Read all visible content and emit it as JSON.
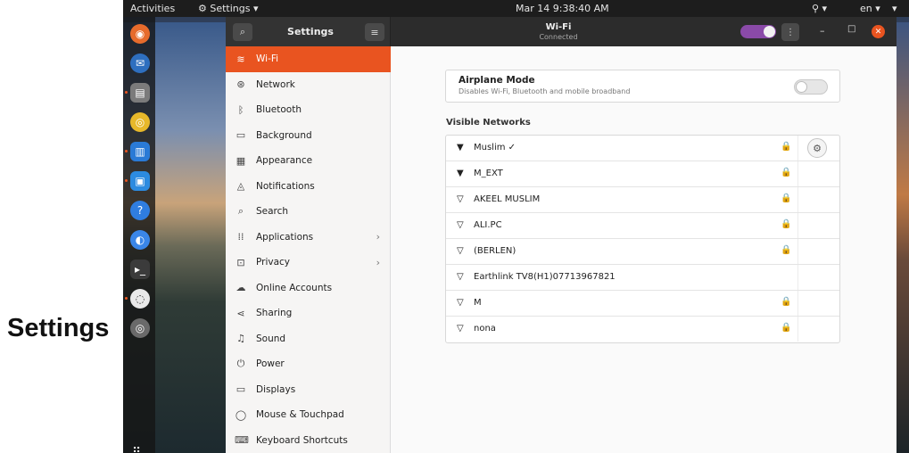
{
  "caption": "Settings",
  "topbar": {
    "activities": "Activities",
    "app_menu": "⚙ Settings ▾",
    "clock": "Mar 14  9:38:40 AM",
    "status": "⚲ ▾",
    "language": "en ▾",
    "menu": "▾"
  },
  "dock": {
    "items": [
      "firefox-icon",
      "thunderbird-icon",
      "files-icon",
      "rhythmbox-icon",
      "writer-icon",
      "software-icon",
      "help-icon",
      "chromium-icon",
      "terminal-icon",
      "chat-icon",
      "settings-icon"
    ],
    "apps_grid": "⠿"
  },
  "headerbar": {
    "sidebar_title": "Settings",
    "search_glyph": "⌕",
    "menu_glyph": "≡",
    "title": "Wi-Fi",
    "subtitle": "Connected",
    "more_glyph": "⋮",
    "minimize_glyph": "–",
    "maximize_glyph": "□",
    "close_glyph": "✕"
  },
  "sidebar": {
    "items": [
      {
        "label": "Wi-Fi",
        "icon": "≋",
        "active": true
      },
      {
        "label": "Network",
        "icon": "⊛"
      },
      {
        "label": "Bluetooth",
        "icon": "ᛒ"
      },
      {
        "label": "Background",
        "icon": "▭"
      },
      {
        "label": "Appearance",
        "icon": "▦"
      },
      {
        "label": "Notifications",
        "icon": "◬"
      },
      {
        "label": "Search",
        "icon": "⌕"
      },
      {
        "label": "Applications",
        "icon": "⁞⁞",
        "chevron": "›"
      },
      {
        "label": "Privacy",
        "icon": "⊡",
        "chevron": "›"
      },
      {
        "label": "Online Accounts",
        "icon": "☁"
      },
      {
        "label": "Sharing",
        "icon": "⋖"
      },
      {
        "label": "Sound",
        "icon": "♫"
      },
      {
        "label": "Power",
        "icon": "⏻"
      },
      {
        "label": "Displays",
        "icon": "▭"
      },
      {
        "label": "Mouse & Touchpad",
        "icon": "◯"
      },
      {
        "label": "Keyboard Shortcuts",
        "icon": "⌨"
      }
    ]
  },
  "airplane": {
    "title": "Airplane Mode",
    "subtitle": "Disables Wi-Fi, Bluetooth and mobile broadband"
  },
  "networks": {
    "heading": "Visible Networks",
    "items": [
      {
        "name": "Muslim ✓",
        "wifi": "▼",
        "lock": "🔒",
        "gear": "⚙"
      },
      {
        "name": "M_EXT",
        "wifi": "▼",
        "lock": "🔒"
      },
      {
        "name": "AKEEL MUSLIM",
        "wifi": "▽",
        "lock": "🔒"
      },
      {
        "name": "ALI.PC",
        "wifi": "▽",
        "lock": "🔒"
      },
      {
        "name": "(BERLEN)",
        "wifi": "▽",
        "lock": "🔒"
      },
      {
        "name": "Earthlink TV8(H1)07713967821",
        "wifi": "▽"
      },
      {
        "name": "M",
        "wifi": "▽",
        "lock": "🔒"
      },
      {
        "name": "nona",
        "wifi": "▽",
        "lock": "🔒"
      }
    ]
  },
  "colors": {
    "accent": "#e95420",
    "toggle_on": "#8a4aa8"
  }
}
